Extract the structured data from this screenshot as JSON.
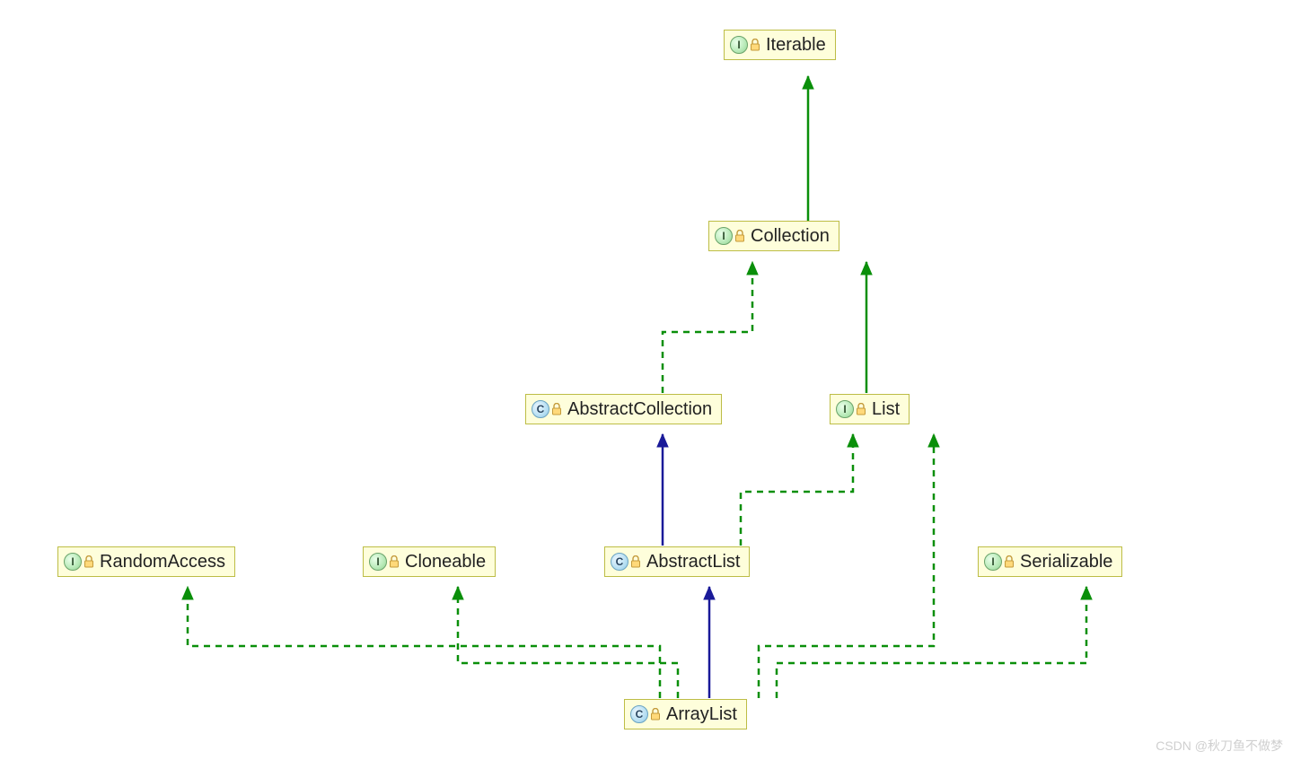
{
  "nodes": {
    "iterable": {
      "label": "Iterable",
      "iconType": "I",
      "abstract": false
    },
    "collection": {
      "label": "Collection",
      "iconType": "I",
      "abstract": false
    },
    "abstractCollection": {
      "label": "AbstractCollection",
      "iconType": "C",
      "abstract": true
    },
    "list": {
      "label": "List",
      "iconType": "I",
      "abstract": false
    },
    "randomAccess": {
      "label": "RandomAccess",
      "iconType": "I",
      "abstract": false
    },
    "cloneable": {
      "label": "Cloneable",
      "iconType": "I",
      "abstract": false
    },
    "abstractList": {
      "label": "AbstractList",
      "iconType": "C",
      "abstract": true
    },
    "serializable": {
      "label": "Serializable",
      "iconType": "I",
      "abstract": false
    },
    "arrayList": {
      "label": "ArrayList",
      "iconType": "C",
      "abstract": false
    }
  },
  "edges": [
    {
      "from": "collection",
      "to": "iterable",
      "style": "solid",
      "color": "green"
    },
    {
      "from": "abstractCollection",
      "to": "collection",
      "style": "dashed",
      "color": "green"
    },
    {
      "from": "list",
      "to": "collection",
      "style": "solid",
      "color": "green"
    },
    {
      "from": "abstractList",
      "to": "abstractCollection",
      "style": "solid",
      "color": "navy"
    },
    {
      "from": "abstractList",
      "to": "list",
      "style": "dashed",
      "color": "green"
    },
    {
      "from": "arrayList",
      "to": "abstractList",
      "style": "solid",
      "color": "navy"
    },
    {
      "from": "arrayList",
      "to": "randomAccess",
      "style": "dashed",
      "color": "green"
    },
    {
      "from": "arrayList",
      "to": "cloneable",
      "style": "dashed",
      "color": "green"
    },
    {
      "from": "arrayList",
      "to": "list",
      "style": "dashed",
      "color": "green"
    },
    {
      "from": "arrayList",
      "to": "serializable",
      "style": "dashed",
      "color": "green"
    }
  ],
  "watermark": "CSDN @秋刀鱼不做梦"
}
